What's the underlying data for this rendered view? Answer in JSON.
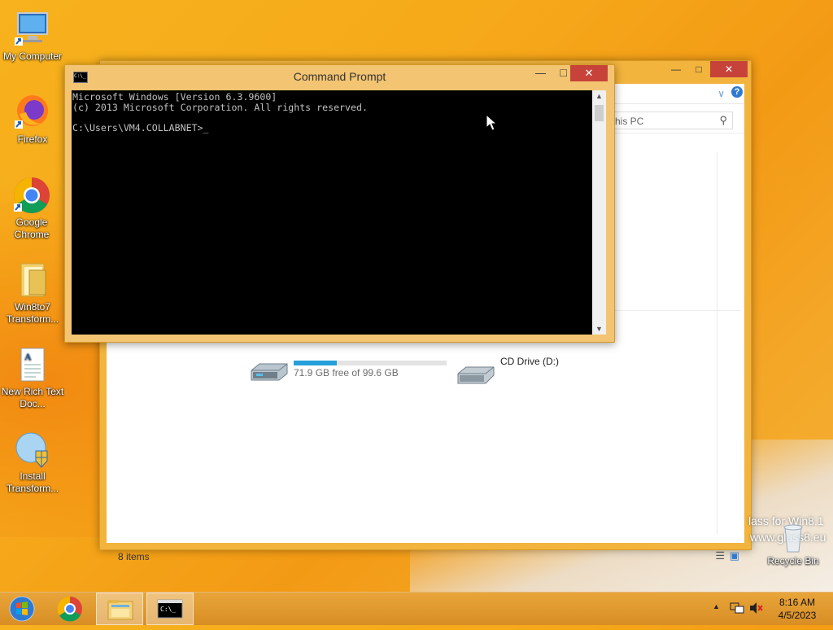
{
  "desktop": {
    "icons": [
      {
        "label": "My Computer",
        "icon": "computer-icon"
      },
      {
        "label": "Firefox",
        "icon": "firefox-icon"
      },
      {
        "label": "Google Chrome",
        "icon": "chrome-icon"
      },
      {
        "label": "Win8to7 Transform...",
        "icon": "folder-icon"
      },
      {
        "label": "New Rich Text Doc...",
        "icon": "document-icon"
      },
      {
        "label": "Install Transform...",
        "icon": "installer-icon"
      }
    ],
    "recycle_bin": "Recycle Bin",
    "watermark_line1": "lass for Win8.1",
    "watermark_line2": "www.glass8.eu"
  },
  "explorer": {
    "search_placeholder": "his PC",
    "drive1_free": "71.9 GB free of 99.6 GB",
    "drive1_usage_fraction": 0.28,
    "drive2_label": "CD Drive (D:)",
    "status_items": "8 items"
  },
  "cmd": {
    "title": "Command Prompt",
    "icon_text": "C:\\_",
    "lines": [
      "Microsoft Windows [Version 6.3.9600]",
      "(c) 2013 Microsoft Corporation. All rights reserved.",
      "",
      "C:\\Users\\VM4.COLLABNET>_"
    ]
  },
  "taskbar": {
    "clock_time": "8:16 AM",
    "clock_date": "4/5/2023"
  },
  "colors": {
    "accent": "#f6a91a",
    "close_red": "#c7433a"
  }
}
